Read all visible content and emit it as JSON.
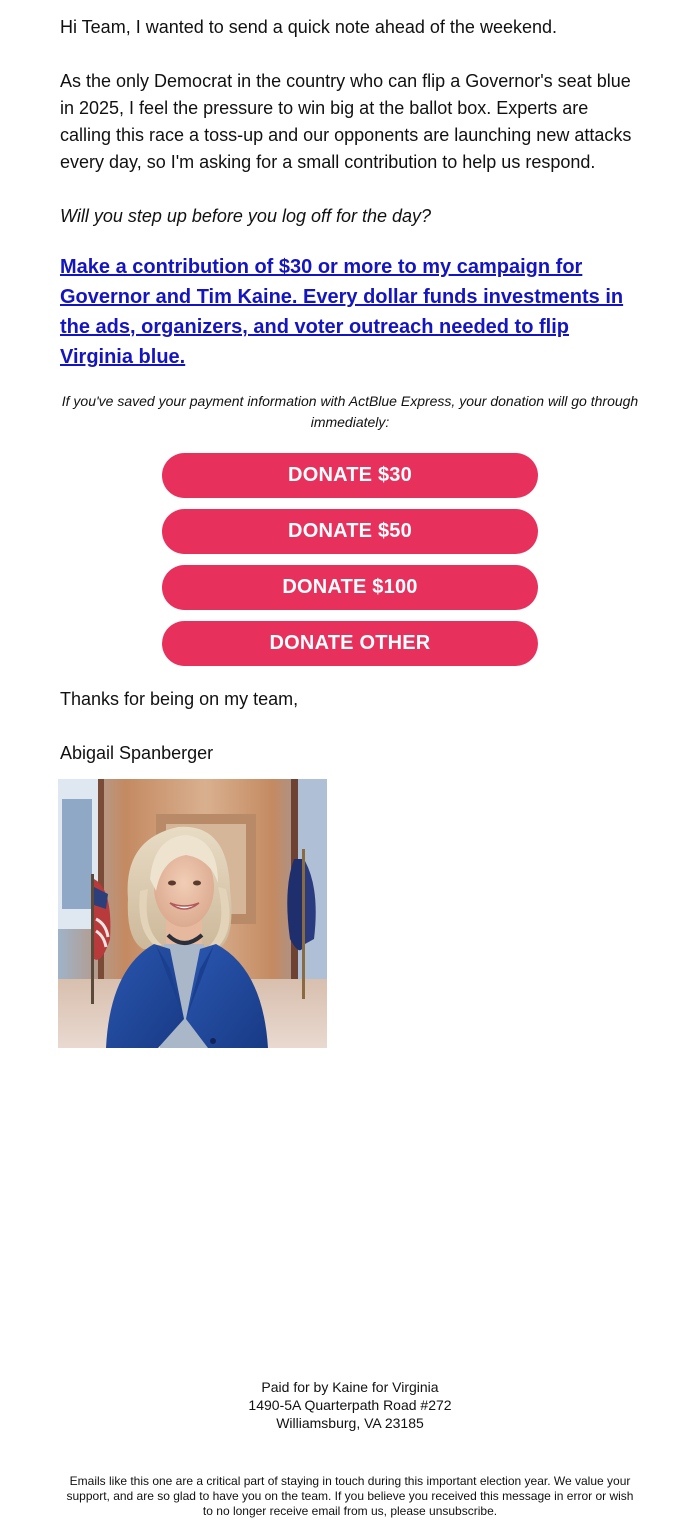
{
  "email": {
    "greeting": "Hi Team, I wanted to send a quick note ahead of the weekend.",
    "body": "As the only Democrat in the country who can flip a Governor's seat blue in 2025, I feel the pressure to win big at the ballot box. Experts are calling this race a toss-up and our opponents are launching new attacks every day, so I'm asking for a small contribution to help us respond.",
    "ask": "Will you step up before you log off for the day?",
    "headline_link": "Make a contribution of $30 or more to my campaign for Governor and Tim Kaine. Every dollar funds investments in the ads, organizers, and voter outreach needed to flip Virginia blue.",
    "express_note": "If you've saved your payment information with ActBlue Express, your donation will go through immediately:",
    "buttons": {
      "donate_30": "DONATE $30",
      "donate_50": "DONATE $50",
      "donate_100": "DONATE $100",
      "donate_other": "DONATE OTHER"
    },
    "thanks": "Thanks for being on my team,",
    "signature": "Abigail Spanberger",
    "footer": {
      "paid_for": "Paid for by Kaine for Virginia",
      "address_line1": "1490-5A Quarterpath Road #272",
      "address_line2": "Williamsburg, VA 23185",
      "legal": "Emails like this one are a critical part of staying in touch during this important election year. We value your support, and are so glad to have you on the team. If you believe you received this message in error or wish to no longer receive email from us, please unsubscribe."
    },
    "colors": {
      "button": "#e8305c",
      "link": "#1515c0"
    }
  }
}
